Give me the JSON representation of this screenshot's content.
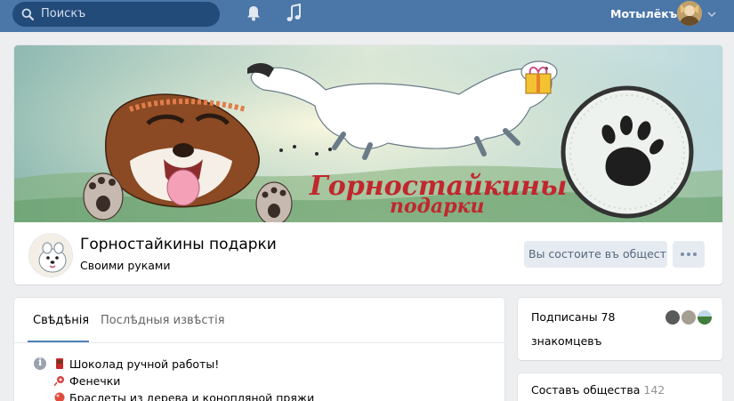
{
  "header": {
    "search_placeholder": "Поискъ",
    "username": "Мотылёкъ"
  },
  "group": {
    "cover_text_line1": "Горностайкины",
    "cover_text_line2": "подарки",
    "title": "Горностайкины подарки",
    "subtitle": "Своими руками",
    "member_button": "Вы состоите въ обществѣ",
    "more_label": "•••"
  },
  "tabs": [
    {
      "label": "Свѣдѣнія",
      "active": true
    },
    {
      "label": "Послѣдныя извѣстія",
      "active": false
    }
  ],
  "description": [
    {
      "icon": "chocolate-icon",
      "text": "Шоколад ручной работы!"
    },
    {
      "icon": "thread-icon",
      "text": "Фенечки"
    },
    {
      "icon": "bead-icon",
      "text": "Браслеты из дерева и конопляной пряжи"
    }
  ],
  "friends": {
    "line1": "Подписаны 78",
    "line2": "знакомцевъ"
  },
  "members": {
    "label": "Составъ общества",
    "count": "142"
  },
  "colors": {
    "header_bg": "#4a76a8",
    "search_bg": "#224b7a",
    "button_bg": "#e5ebf1",
    "accent": "#5181b8",
    "page_bg": "#edeef0"
  }
}
